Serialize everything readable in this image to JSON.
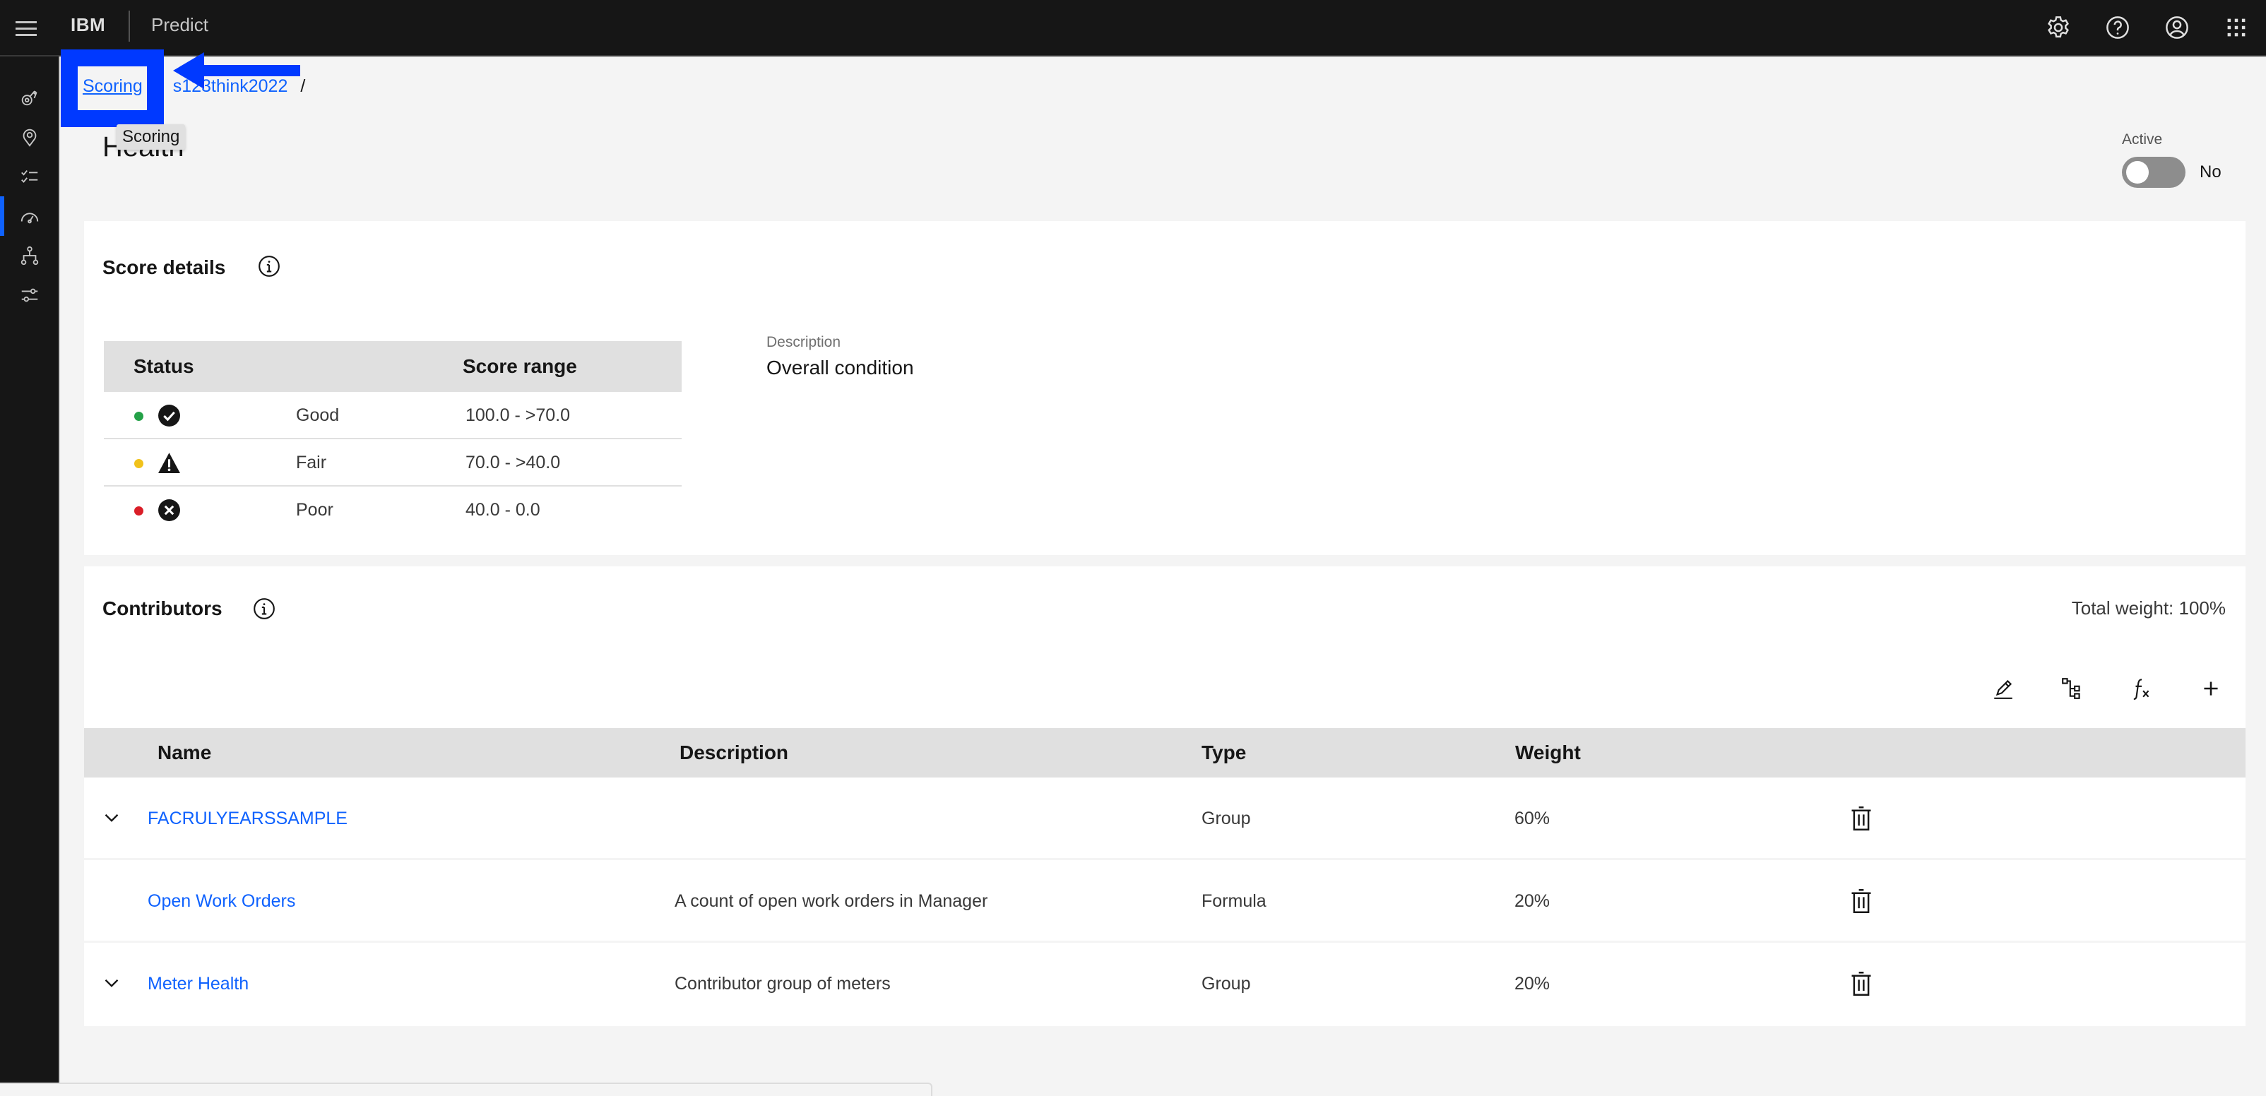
{
  "header": {
    "brand": "IBM",
    "product": "Predict",
    "actions": [
      {
        "name": "settings",
        "icon": "gear-icon"
      },
      {
        "name": "help",
        "icon": "help-icon"
      },
      {
        "name": "user",
        "icon": "user-avatar-icon"
      },
      {
        "name": "app-switcher",
        "icon": "app-grid-icon"
      }
    ]
  },
  "sidenav": {
    "items": [
      {
        "icon": "asset-icon",
        "active": false
      },
      {
        "icon": "location-icon",
        "active": false
      },
      {
        "icon": "checklist-icon",
        "active": false
      },
      {
        "icon": "gauge-icon",
        "active": true
      },
      {
        "icon": "hierarchy-icon",
        "active": false
      },
      {
        "icon": "sliders-icon",
        "active": false
      }
    ]
  },
  "breadcrumb": {
    "items": [
      "Scoring",
      "s123think2022"
    ],
    "separator": "/"
  },
  "tooltip": "Scoring",
  "page": {
    "title": "Health",
    "active_label": "Active",
    "active_value": "No",
    "active_on": false
  },
  "score_details": {
    "title": "Score details",
    "headers": {
      "status": "Status",
      "range": "Score range"
    },
    "rows": [
      {
        "status": "Good",
        "range": "100.0 - >70.0",
        "color": "#24a148",
        "icon": "checkmark-filled-icon"
      },
      {
        "status": "Fair",
        "range": "70.0 - >40.0",
        "color": "#f1c21b",
        "icon": "warning-filled-icon"
      },
      {
        "status": "Poor",
        "range": "40.0 - 0.0",
        "color": "#da1e28",
        "icon": "error-filled-icon"
      }
    ],
    "description_label": "Description",
    "description_value": "Overall condition"
  },
  "contributors": {
    "title": "Contributors",
    "total_weight": "Total weight: 100%",
    "toolbar": [
      {
        "name": "edit",
        "icon": "edit-icon"
      },
      {
        "name": "add-group",
        "icon": "hierarchy-add-icon"
      },
      {
        "name": "add-formula",
        "icon": "function-icon"
      },
      {
        "name": "add",
        "icon": "add-icon"
      }
    ],
    "headers": {
      "name": "Name",
      "description": "Description",
      "type": "Type",
      "weight": "Weight"
    },
    "rows": [
      {
        "name": "FACRULYEARSSAMPLE",
        "description": "",
        "type": "Group",
        "weight": "60%",
        "expandable": true
      },
      {
        "name": "Open Work Orders",
        "description": "A count of open work orders in Manager",
        "type": "Formula",
        "weight": "20%",
        "expandable": false
      },
      {
        "name": "Meter Health",
        "description": "Contributor group of meters",
        "type": "Group",
        "weight": "20%",
        "expandable": true
      }
    ]
  },
  "colors": {
    "accent": "#0f62fe",
    "annotation": "#0039ff",
    "topbar": "#161616"
  }
}
